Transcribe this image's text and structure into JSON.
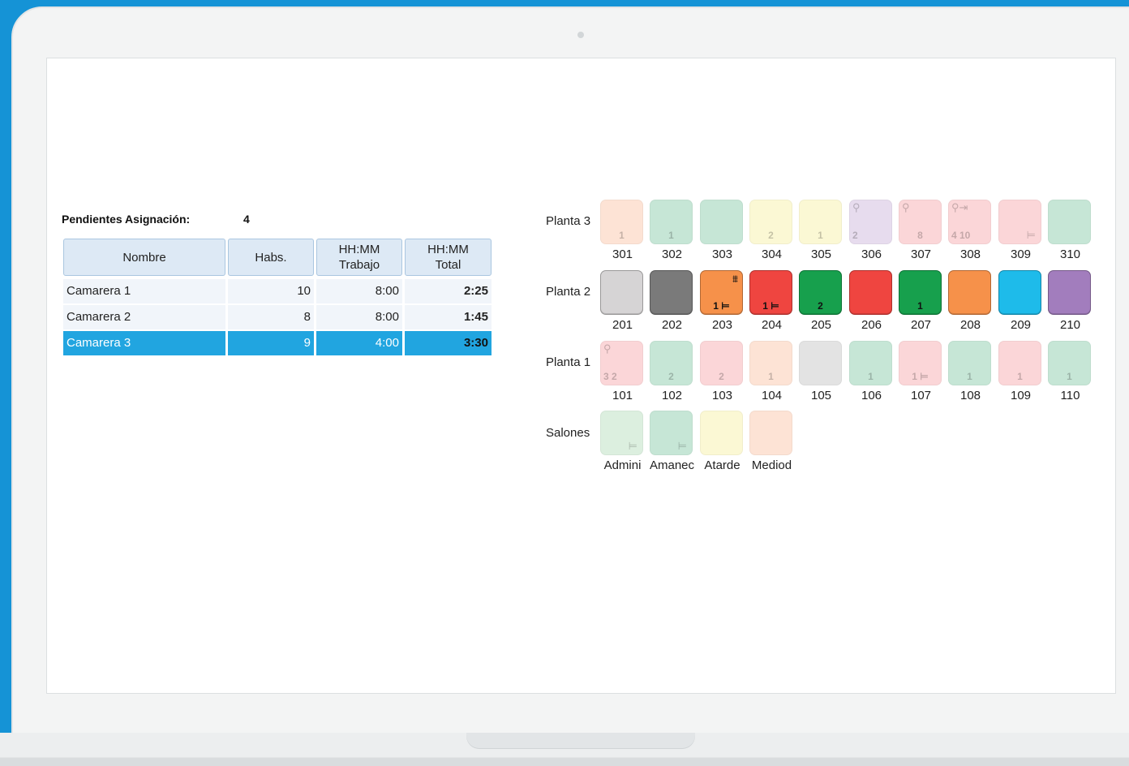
{
  "pending": {
    "label": "Pendientes Asignación:",
    "value": "4"
  },
  "table": {
    "headers": [
      {
        "line1": "Nombre",
        "line2": ""
      },
      {
        "line1": "Habs.",
        "line2": ""
      },
      {
        "line1": "HH:MM",
        "line2": "Trabajo"
      },
      {
        "line1": "HH:MM",
        "line2": "Total"
      }
    ],
    "rows": [
      {
        "nombre": "Camarera 1",
        "habs": "10",
        "trabajo": "8:00",
        "total": "2:25",
        "selected": false
      },
      {
        "nombre": "Camarera 2",
        "habs": "8",
        "trabajo": "8:00",
        "total": "1:45",
        "selected": false
      },
      {
        "nombre": "Camarera 3",
        "habs": "9",
        "trabajo": "4:00",
        "total": "3:30",
        "selected": true
      }
    ],
    "selected_color": "#21a5e0"
  },
  "floors": [
    {
      "label": "Planta 3",
      "rooms": [
        {
          "num": "301",
          "color": "#fde3d5",
          "tl": "",
          "tr": "",
          "bl": "",
          "bc": "1",
          "br": "",
          "faded": true
        },
        {
          "num": "302",
          "color": "#c6e6d6",
          "tl": "",
          "tr": "",
          "bl": "",
          "bc": "1",
          "br": "",
          "faded": true
        },
        {
          "num": "303",
          "color": "#c6e6d6",
          "tl": "",
          "tr": "",
          "bl": "",
          "bc": "",
          "br": "",
          "faded": true
        },
        {
          "num": "304",
          "color": "#fbf8d4",
          "tl": "",
          "tr": "",
          "bl": "",
          "bc": "2",
          "br": "",
          "faded": true
        },
        {
          "num": "305",
          "color": "#fbf8d4",
          "tl": "",
          "tr": "",
          "bl": "",
          "bc": "1",
          "br": "",
          "faded": true
        },
        {
          "num": "306",
          "color": "#e7dcee",
          "tl": "⚲",
          "tr": "",
          "bl": "2",
          "bc": "",
          "br": "",
          "faded": true
        },
        {
          "num": "307",
          "color": "#fbd6d8",
          "tl": "⚲",
          "tr": "",
          "bl": "",
          "bc": "8",
          "br": "",
          "faded": true
        },
        {
          "num": "308",
          "color": "#fbd6d8",
          "tl": "⚲⇥",
          "tr": "",
          "bl": "4 10",
          "bc": "",
          "br": "",
          "faded": true
        },
        {
          "num": "309",
          "color": "#fbd6d8",
          "tl": "",
          "tr": "",
          "bl": "",
          "bc": "",
          "br": "⊨",
          "faded": true
        },
        {
          "num": "310",
          "color": "#c6e6d6",
          "tl": "",
          "tr": "",
          "bl": "",
          "bc": "",
          "br": "",
          "faded": true
        }
      ]
    },
    {
      "label": "Planta 2",
      "rooms": [
        {
          "num": "201",
          "color": "#d6d4d5",
          "tl": "",
          "tr": "",
          "bl": "",
          "bc": "",
          "br": "",
          "faded": false
        },
        {
          "num": "202",
          "color": "#7a7a7a",
          "tl": "",
          "tr": "",
          "bl": "",
          "bc": "",
          "br": "",
          "faded": false
        },
        {
          "num": "203",
          "color": "#f6914a",
          "tl": "",
          "tr": "⩩",
          "bl": "",
          "bc": "1 ⊨",
          "br": "",
          "faded": false
        },
        {
          "num": "204",
          "color": "#ef4540",
          "tl": "",
          "tr": "",
          "bl": "",
          "bc": "1 ⊨",
          "br": "",
          "faded": false
        },
        {
          "num": "205",
          "color": "#17a04d",
          "tl": "",
          "tr": "",
          "bl": "",
          "bc": "2",
          "br": "",
          "faded": false
        },
        {
          "num": "206",
          "color": "#ef4540",
          "tl": "",
          "tr": "",
          "bl": "",
          "bc": "",
          "br": "",
          "faded": false
        },
        {
          "num": "207",
          "color": "#17a04d",
          "tl": "",
          "tr": "",
          "bl": "",
          "bc": "1",
          "br": "",
          "faded": false
        },
        {
          "num": "208",
          "color": "#f6914a",
          "tl": "",
          "tr": "",
          "bl": "",
          "bc": "",
          "br": "",
          "faded": false
        },
        {
          "num": "209",
          "color": "#1ebbea",
          "tl": "",
          "tr": "",
          "bl": "",
          "bc": "",
          "br": "",
          "faded": false
        },
        {
          "num": "210",
          "color": "#a27dbd",
          "tl": "",
          "tr": "",
          "bl": "",
          "bc": "",
          "br": "",
          "faded": false
        }
      ]
    },
    {
      "label": "Planta 1",
      "rooms": [
        {
          "num": "101",
          "color": "#fbd6d8",
          "tl": "⚲",
          "tr": "",
          "bl": "3 2",
          "bc": "",
          "br": "",
          "faded": true
        },
        {
          "num": "102",
          "color": "#c6e6d6",
          "tl": "",
          "tr": "",
          "bl": "",
          "bc": "2",
          "br": "",
          "faded": true
        },
        {
          "num": "103",
          "color": "#fbd6d8",
          "tl": "",
          "tr": "",
          "bl": "",
          "bc": "2",
          "br": "",
          "faded": true
        },
        {
          "num": "104",
          "color": "#fde3d5",
          "tl": "",
          "tr": "",
          "bl": "",
          "bc": "1",
          "br": "",
          "faded": true
        },
        {
          "num": "105",
          "color": "#e3e3e3",
          "tl": "",
          "tr": "",
          "bl": "",
          "bc": "",
          "br": "",
          "faded": true
        },
        {
          "num": "106",
          "color": "#c6e6d6",
          "tl": "",
          "tr": "",
          "bl": "",
          "bc": "1",
          "br": "",
          "faded": true
        },
        {
          "num": "107",
          "color": "#fbd6d8",
          "tl": "",
          "tr": "",
          "bl": "",
          "bc": "1 ⊨",
          "br": "",
          "faded": true
        },
        {
          "num": "108",
          "color": "#c6e6d6",
          "tl": "",
          "tr": "",
          "bl": "",
          "bc": "1",
          "br": "",
          "faded": true
        },
        {
          "num": "109",
          "color": "#fbd6d8",
          "tl": "",
          "tr": "",
          "bl": "",
          "bc": "1",
          "br": "",
          "faded": true
        },
        {
          "num": "110",
          "color": "#c6e6d6",
          "tl": "",
          "tr": "",
          "bl": "",
          "bc": "1",
          "br": "",
          "faded": true
        }
      ]
    },
    {
      "label": "Salones",
      "rooms": [
        {
          "num": "Admini",
          "color": "#dcefdf",
          "tl": "",
          "tr": "",
          "bl": "",
          "bc": "",
          "br": "⊨",
          "faded": true
        },
        {
          "num": "Amanec",
          "color": "#c6e6d6",
          "tl": "",
          "tr": "",
          "bl": "",
          "bc": "",
          "br": "⊨",
          "faded": true
        },
        {
          "num": "Atarde",
          "color": "#fbf8d4",
          "tl": "",
          "tr": "",
          "bl": "",
          "bc": "",
          "br": "",
          "faded": true
        },
        {
          "num": "Mediod",
          "color": "#fde3d5",
          "tl": "",
          "tr": "",
          "bl": "",
          "bc": "",
          "br": "",
          "faded": true
        }
      ]
    }
  ]
}
